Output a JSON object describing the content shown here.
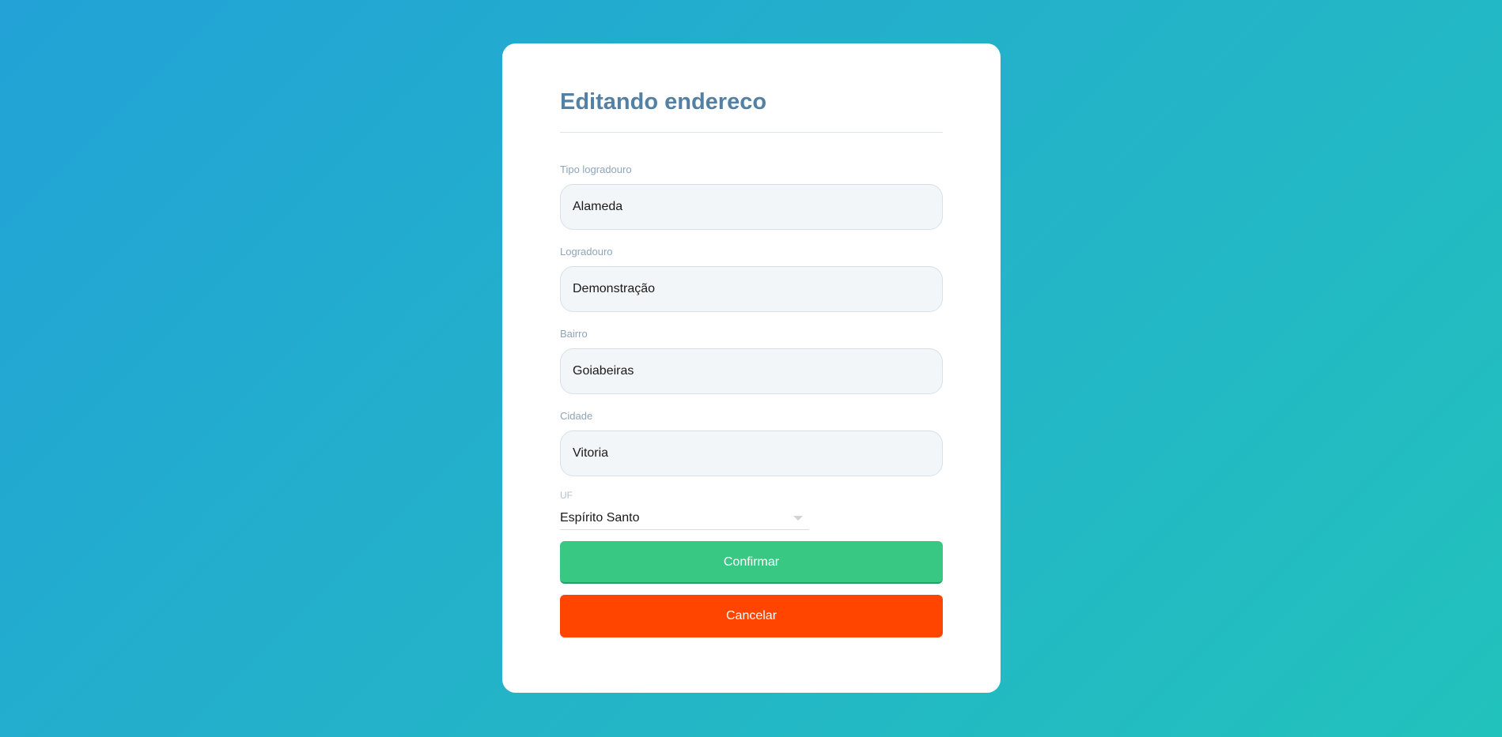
{
  "form": {
    "title": "Editando endereco",
    "fields": [
      {
        "label": "Tipo logradouro",
        "value": "Alameda"
      },
      {
        "label": "Logradouro",
        "value": "Demonstração"
      },
      {
        "label": "Bairro",
        "value": "Goiabeiras"
      },
      {
        "label": "Cidade",
        "value": "Vitoria"
      }
    ],
    "uf": {
      "label": "UF",
      "selected": "Espírito Santo"
    },
    "buttons": {
      "confirm_label": "Confirmar",
      "cancel_label": "Cancelar"
    }
  },
  "colors": {
    "title": "#5481a3",
    "confirm": "#38c884",
    "cancel": "#ff4500",
    "background_start": "#22a2d6",
    "background_end": "#22c2bc"
  },
  "icons": {
    "uf_dropdown": "chevron-down-icon"
  }
}
